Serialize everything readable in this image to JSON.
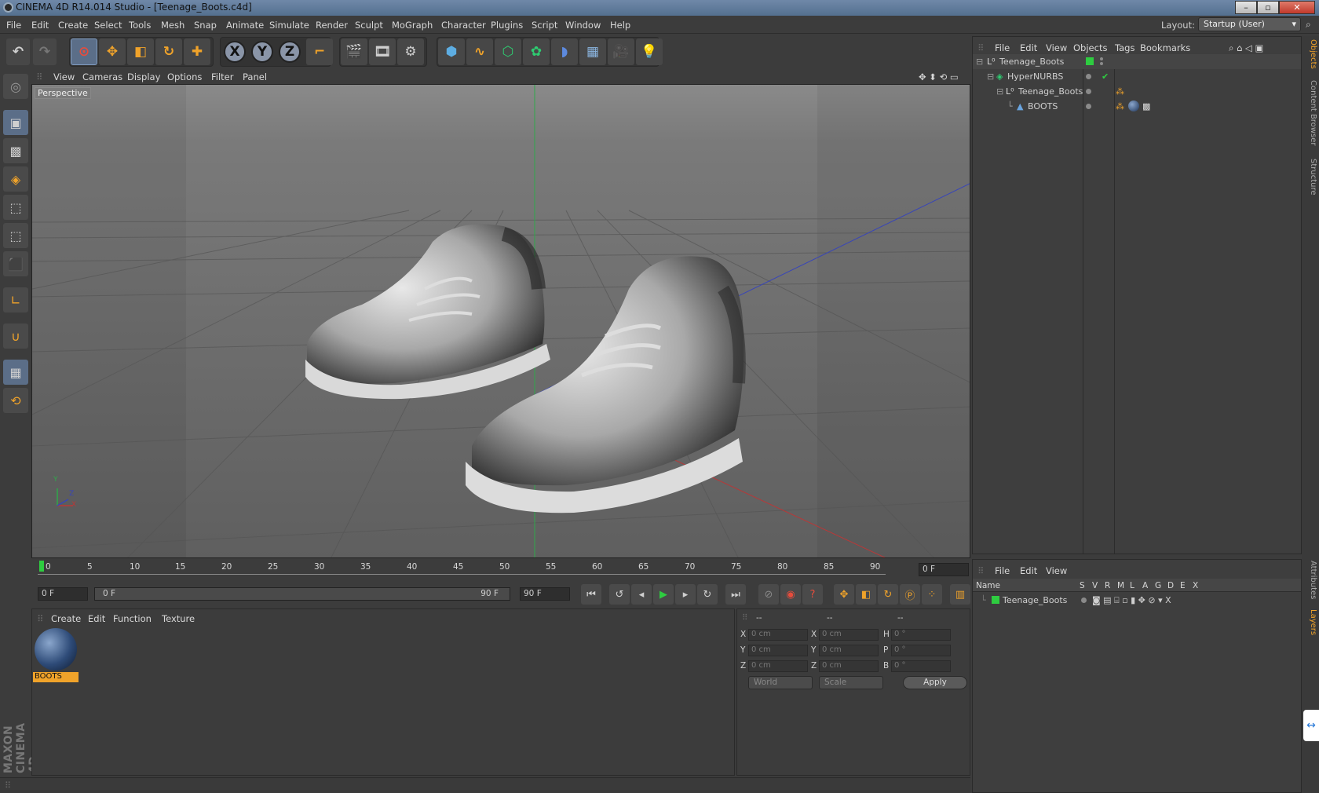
{
  "window": {
    "title": "CINEMA 4D R14.014 Studio - [Teenage_Boots.c4d]",
    "minimize": "–",
    "maximize": "▫",
    "close": "✕"
  },
  "menubar": {
    "items": [
      "File",
      "Edit",
      "Create",
      "Select",
      "Tools",
      "Mesh",
      "Snap",
      "Animate",
      "Simulate",
      "Render",
      "Sculpt",
      "MoGraph",
      "Character",
      "Plugins",
      "Script",
      "Window",
      "Help"
    ],
    "layout_label": "Layout:",
    "layout_value": "Startup (User)"
  },
  "toolbar": {
    "axis_x": "X",
    "axis_y": "Y",
    "axis_z": "Z"
  },
  "viewport": {
    "menu": [
      "View",
      "Cameras",
      "Display",
      "Options",
      "Filter",
      "Panel"
    ],
    "label": "Perspective",
    "axis_y": "Y",
    "axis_z": "Z",
    "axis_x": "X"
  },
  "timeline": {
    "ticks": [
      "0",
      "5",
      "10",
      "15",
      "20",
      "25",
      "30",
      "35",
      "40",
      "45",
      "50",
      "55",
      "60",
      "65",
      "70",
      "75",
      "80",
      "85",
      "90"
    ],
    "current_frame": "0 F"
  },
  "controls": {
    "start_frame": "0 F",
    "range_start": "0 F",
    "range_end": "90 F",
    "end_frame": "90 F"
  },
  "materials": {
    "menu": [
      "Create",
      "Edit",
      "Function",
      "Texture"
    ],
    "items": [
      {
        "name": "BOOTS"
      }
    ]
  },
  "coords": {
    "headers": [
      "--",
      "--",
      "--"
    ],
    "rows": [
      {
        "a": "X",
        "a_val": "0 cm",
        "b": "X",
        "b_val": "0 cm",
        "c": "H",
        "c_val": "0 °"
      },
      {
        "a": "Y",
        "a_val": "0 cm",
        "b": "Y",
        "b_val": "0 cm",
        "c": "P",
        "c_val": "0 °"
      },
      {
        "a": "Z",
        "a_val": "0 cm",
        "b": "Z",
        "b_val": "0 cm",
        "c": "B",
        "c_val": "0 °"
      }
    ],
    "space": "World",
    "mode": "Scale",
    "apply": "Apply"
  },
  "objects": {
    "menu": [
      "File",
      "Edit",
      "View",
      "Objects",
      "Tags",
      "Bookmarks"
    ],
    "tree": [
      {
        "name": "Teenage_Boots"
      },
      {
        "name": "HyperNURBS"
      },
      {
        "name": "Teenage_Boots"
      },
      {
        "name": "BOOTS"
      }
    ]
  },
  "layers": {
    "menu": [
      "File",
      "Edit",
      "View"
    ],
    "columns": [
      "Name",
      "S",
      "V",
      "R",
      "M",
      "L",
      "A",
      "G",
      "D",
      "E",
      "X"
    ],
    "rows": [
      {
        "name": "Teenage_Boots",
        "color": "#2ecc40"
      }
    ]
  },
  "side_tabs": [
    "Objects",
    "Content Browser",
    "Structure",
    "Attributes",
    "Layers"
  ],
  "branding": "MAXON CINEMA 4D",
  "colors": {
    "accent": "#f0a32a",
    "selection": "#5b6e88",
    "layer_green": "#2ecc40"
  }
}
